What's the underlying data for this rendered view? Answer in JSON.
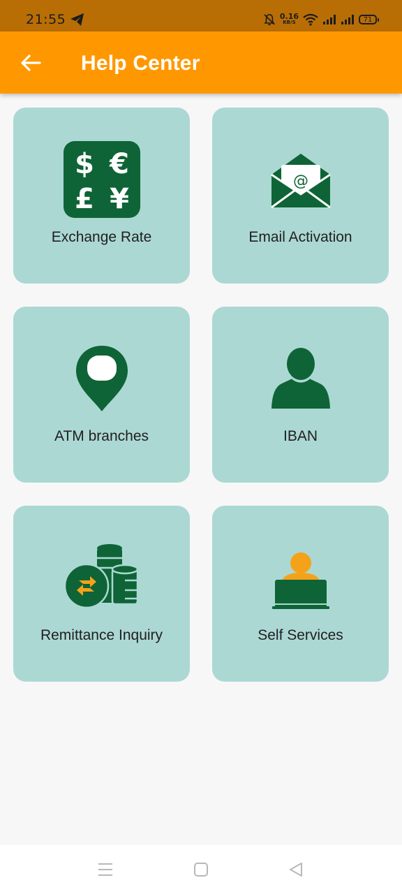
{
  "status_bar": {
    "time": "21:55",
    "net_speed_value": "0.16",
    "net_speed_unit": "KB/S",
    "battery": "71"
  },
  "app_bar": {
    "title": "Help Center",
    "color": "#ff9800"
  },
  "cards": [
    {
      "label": "Exchange Rate",
      "icon": "currency-exchange-icon"
    },
    {
      "label": "Email Activation",
      "icon": "email-icon"
    },
    {
      "label": "ATM branches",
      "icon": "location-pin-icon"
    },
    {
      "label": "IBAN",
      "icon": "person-icon"
    },
    {
      "label": "Remittance Inquiry",
      "icon": "coins-transfer-icon"
    },
    {
      "label": "Self Services",
      "icon": "laptop-user-icon"
    }
  ],
  "theme": {
    "card_bg": "#acd8d4",
    "icon_green": "#0e6436",
    "accent_orange": "#f5a21b"
  }
}
